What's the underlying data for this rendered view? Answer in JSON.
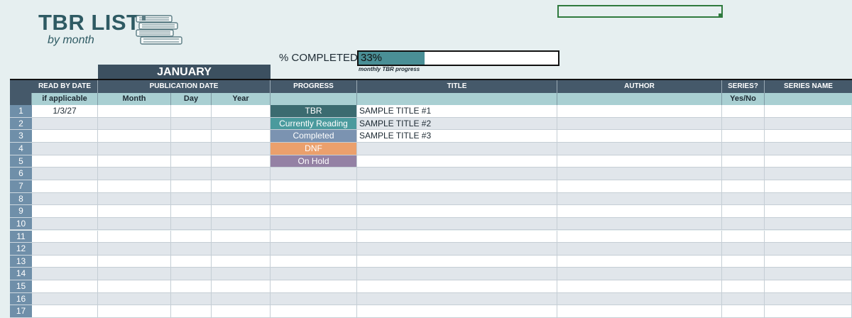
{
  "header": {
    "title": "TBR LIST",
    "subtitle": "by month",
    "books_icon": "stacked-books-icon"
  },
  "progress_summary": {
    "label": "% COMPLETED",
    "value_text": "33%",
    "fraction": 0.33,
    "note": "monthly TBR progress"
  },
  "month_band": "JANUARY",
  "columns": {
    "read_by": "READ BY DATE",
    "publication": "PUBLICATION DATE",
    "progress": "PROGRESS",
    "title": "TITLE",
    "author": "AUTHOR",
    "series": "SERIES?",
    "series_name": "SERIES NAME"
  },
  "subheaders": {
    "read_by": "if applicable",
    "month": "Month",
    "day": "Day",
    "year": "Year",
    "series": "Yes/No"
  },
  "status_colors": {
    "TBR": "#3b6b70",
    "Currently Reading": "#4a9a9d",
    "Completed": "#7b93b1",
    "DNF": "#eba06c",
    "On Hold": "#9481a4"
  },
  "rows": [
    {
      "num": "1",
      "read_by": "1/3/27",
      "progress": "TBR",
      "title": "SAMPLE TITLE #1"
    },
    {
      "num": "2",
      "read_by": "",
      "progress": "Currently Reading",
      "title": "SAMPLE TITLE #2"
    },
    {
      "num": "3",
      "read_by": "",
      "progress": "Completed",
      "title": "SAMPLE TITLE #3"
    },
    {
      "num": "4",
      "read_by": "",
      "progress": "DNF",
      "title": ""
    },
    {
      "num": "5",
      "read_by": "",
      "progress": "On Hold",
      "title": ""
    },
    {
      "num": "6",
      "read_by": "",
      "progress": "",
      "title": ""
    },
    {
      "num": "7",
      "read_by": "",
      "progress": "",
      "title": ""
    },
    {
      "num": "8",
      "read_by": "",
      "progress": "",
      "title": ""
    },
    {
      "num": "9",
      "read_by": "",
      "progress": "",
      "title": ""
    },
    {
      "num": "10",
      "read_by": "",
      "progress": "",
      "title": ""
    },
    {
      "num": "11",
      "read_by": "",
      "progress": "",
      "title": ""
    },
    {
      "num": "12",
      "read_by": "",
      "progress": "",
      "title": ""
    },
    {
      "num": "13",
      "read_by": "",
      "progress": "",
      "title": ""
    },
    {
      "num": "14",
      "read_by": "",
      "progress": "",
      "title": ""
    },
    {
      "num": "15",
      "read_by": "",
      "progress": "",
      "title": ""
    },
    {
      "num": "16",
      "read_by": "",
      "progress": "",
      "title": ""
    },
    {
      "num": "17",
      "read_by": "",
      "progress": "",
      "title": ""
    }
  ]
}
